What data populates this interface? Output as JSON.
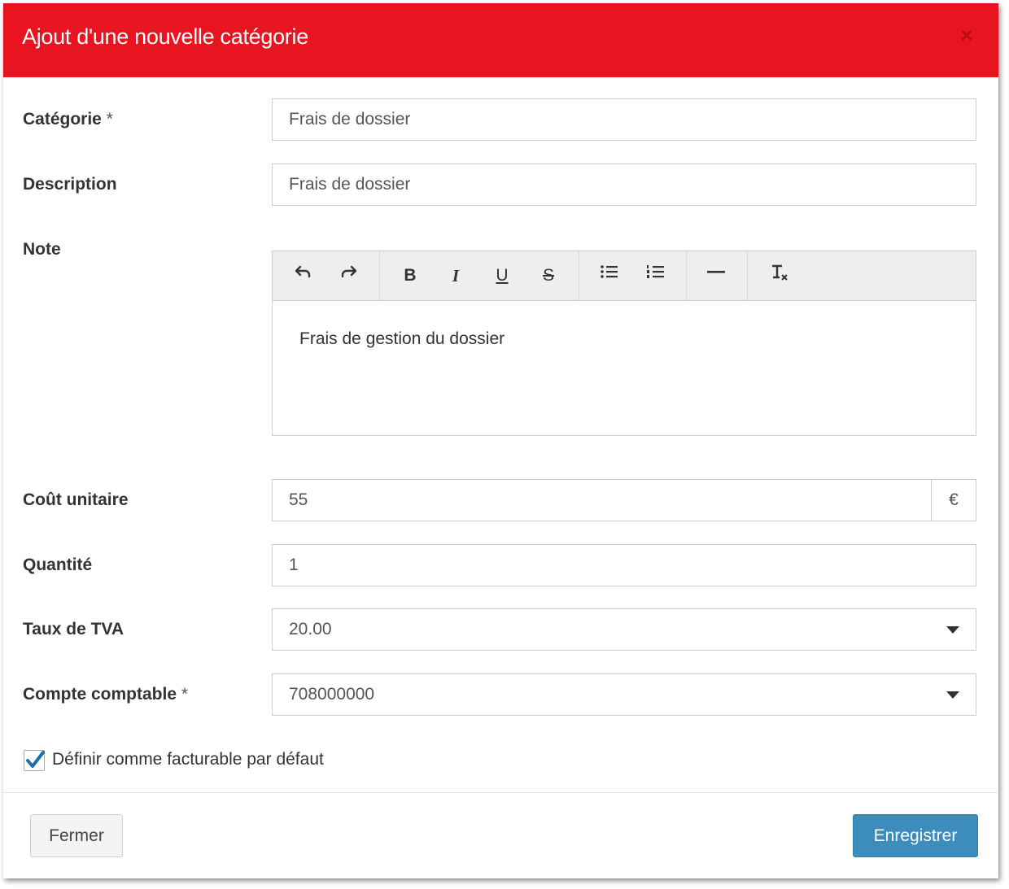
{
  "modal": {
    "title": "Ajout d'une nouvelle catégorie",
    "close_icon": "×"
  },
  "form": {
    "categorie": {
      "label": "Catégorie",
      "required": "*",
      "value": "Frais de dossier"
    },
    "description": {
      "label": "Description",
      "value": "Frais de dossier"
    },
    "note": {
      "label": "Note",
      "toolbar": [
        "undo-icon",
        "redo-icon",
        "bold-icon",
        "italic-icon",
        "underline-icon",
        "strikethrough-icon",
        "bullet-list-icon",
        "numbered-list-icon",
        "horizontal-rule-icon",
        "clear-format-icon"
      ],
      "content": "Frais de gestion du dossier"
    },
    "cout_unitaire": {
      "label": "Coût unitaire",
      "value": "55",
      "addon": "€"
    },
    "quantite": {
      "label": "Quantité",
      "value": "1"
    },
    "taux_tva": {
      "label": "Taux de TVA",
      "value": "20.00"
    },
    "compte_comptable": {
      "label": "Compte comptable",
      "required": "*",
      "value": "708000000"
    },
    "facturable": {
      "label": "Définir comme facturable par défaut",
      "checked": true
    }
  },
  "footer": {
    "close_label": "Fermer",
    "save_label": "Enregistrer"
  },
  "colors": {
    "header": "#e8141f",
    "primary": "#3c8dbc",
    "check": "#1e6fa8"
  }
}
